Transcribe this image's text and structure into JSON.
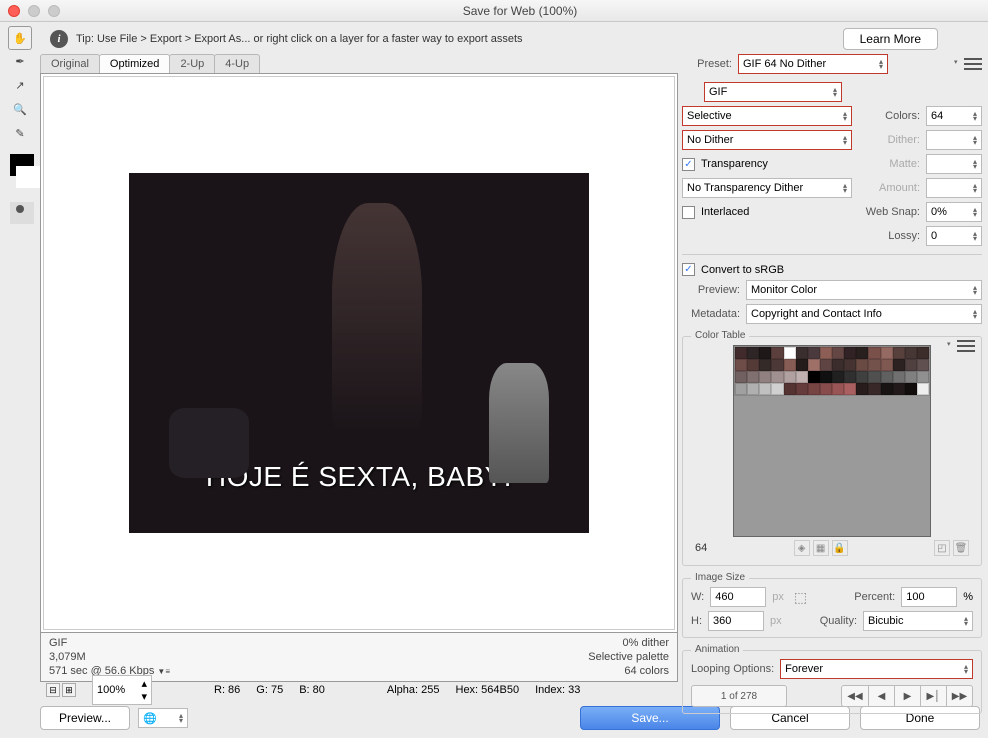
{
  "window": {
    "title": "Save for Web (100%)"
  },
  "tip": {
    "text": "Tip: Use File > Export > Export As...  or right click on a layer for a faster way to export assets",
    "learn_more": "Learn More"
  },
  "tabs": {
    "original": "Original",
    "optimized": "Optimized",
    "twoup": "2-Up",
    "fourup": "4-Up"
  },
  "preview_img": {
    "caption": "HOJE É SEXTA, BABY!"
  },
  "preview_info": {
    "format": "GIF",
    "size": "3,079M",
    "time": "571 sec @ 56.6 Kbps",
    "dither_pct": "0% dither",
    "palette": "Selective palette",
    "colors": "64 colors"
  },
  "zoom": {
    "value": "100%"
  },
  "pixel_info": {
    "r": "R: 86",
    "g": "G: 75",
    "b": "B: 80",
    "alpha": "Alpha: 255",
    "hex": "Hex: 564B50",
    "index": "Index: 33"
  },
  "preset": {
    "label": "Preset:",
    "value": "GIF 64 No Dither"
  },
  "format": {
    "value": "GIF"
  },
  "reduction": {
    "value": "Selective"
  },
  "colors": {
    "label": "Colors:",
    "value": "64"
  },
  "dither_alg": {
    "value": "No Dither"
  },
  "dither_lbl": {
    "label": "Dither:",
    "value": ""
  },
  "transparency": {
    "label": "Transparency",
    "matte_label": "Matte:"
  },
  "trans_dither": {
    "value": "No Transparency Dither"
  },
  "amount": {
    "label": "Amount:",
    "value": ""
  },
  "interlaced": {
    "label": "Interlaced"
  },
  "websnap": {
    "label": "Web Snap:",
    "value": "0%"
  },
  "lossy": {
    "label": "Lossy:",
    "value": "0"
  },
  "srgb": {
    "label": "Convert to sRGB"
  },
  "preview_sel": {
    "label": "Preview:",
    "value": "Monitor Color"
  },
  "metadata": {
    "label": "Metadata:",
    "value": "Copyright and Contact Info"
  },
  "color_table": {
    "title": "Color Table",
    "count": "64"
  },
  "image_size": {
    "title": "Image Size",
    "w_label": "W:",
    "w": "460",
    "h_label": "H:",
    "h": "360",
    "px": "px",
    "percent_label": "Percent:",
    "percent": "100",
    "pct_sym": "%",
    "quality_label": "Quality:",
    "quality": "Bicubic"
  },
  "animation": {
    "title": "Animation",
    "loop_label": "Looping Options:",
    "loop_value": "Forever",
    "page": "1 of 278"
  },
  "buttons": {
    "preview": "Preview...",
    "save": "Save...",
    "cancel": "Cancel",
    "done": "Done"
  },
  "ct_colors": [
    "#402a2b",
    "#2e2526",
    "#1e1818",
    "#5a3f3c",
    "#ffffff",
    "#3b2e2f",
    "#4a3a3e",
    "#8c5e55",
    "#644644",
    "#302225",
    "#28201f",
    "#7a514a",
    "#946a62",
    "#58413d",
    "#463634",
    "#3c2c2a",
    "#6e4c48",
    "#553b38",
    "#342a28",
    "#4c3836",
    "#865c54",
    "#241c1b",
    "#9e7068",
    "#5e4543",
    "#3a2d2c",
    "#443330",
    "#6a4b44",
    "#74524c",
    "#805852",
    "#2c2221",
    "#504040",
    "#605050",
    "#706060",
    "#807070",
    "#908080",
    "#a09090",
    "#b0a0a0",
    "#c0b0b0",
    "#000000",
    "#101010",
    "#202020",
    "#303030",
    "#404040",
    "#505050",
    "#606060",
    "#707070",
    "#808080",
    "#909090",
    "#a0a0a0",
    "#b0b0b0",
    "#c0c0c0",
    "#d0d0d0",
    "#553333",
    "#663b3b",
    "#774444",
    "#884c4c",
    "#995555",
    "#aa6060",
    "#281c1c",
    "#382828",
    "#181414",
    "#221a1a",
    "#120e0e",
    "#eeeeee"
  ]
}
